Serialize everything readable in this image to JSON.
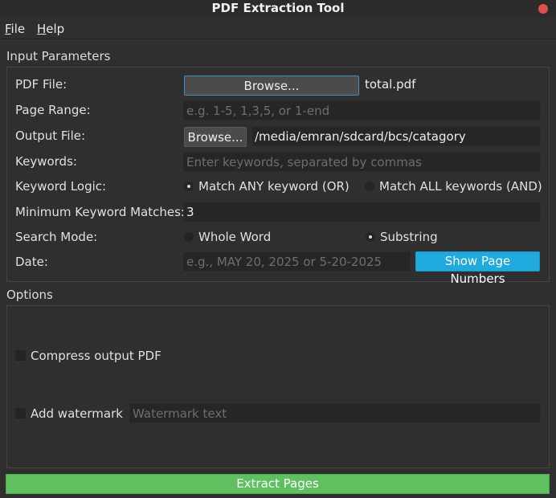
{
  "window": {
    "title": "PDF Extraction Tool"
  },
  "menu": {
    "file": {
      "accel": "F",
      "rest": "ile"
    },
    "help": {
      "accel": "H",
      "rest": "elp"
    }
  },
  "input_group": {
    "title": "Input Parameters",
    "pdf_file": {
      "label": "PDF File:",
      "button": "Browse...",
      "value": "total.pdf"
    },
    "page_range": {
      "label": "Page Range:",
      "placeholder": "e.g. 1-5, 1,3,5, or 1-end",
      "value": ""
    },
    "output_file": {
      "label": "Output File:",
      "button": "Browse...",
      "value": "/media/emran/sdcard/bcs/catagory"
    },
    "keywords": {
      "label": "Keywords:",
      "placeholder": "Enter keywords, separated by commas",
      "value": ""
    },
    "keyword_logic": {
      "label": "Keyword Logic:",
      "options": [
        "Match ANY keyword (OR)",
        "Match ALL keywords (AND)"
      ],
      "selected": "Match ANY keyword (OR)"
    },
    "min_matches": {
      "label": "Minimum Keyword Matches:",
      "value": "3"
    },
    "search_mode": {
      "label": "Search Mode:",
      "options": [
        "Whole Word",
        "Substring"
      ],
      "selected": "Substring"
    },
    "date": {
      "label": "Date:",
      "placeholder": "e.g., MAY 20, 2025 or 5-20-2025",
      "value": "",
      "button": "Show Page Numbers"
    }
  },
  "options_group": {
    "title": "Options",
    "compress": {
      "label": "Compress output PDF",
      "checked": false
    },
    "watermark": {
      "label": "Add watermark",
      "checked": false,
      "placeholder": "Watermark text",
      "value": ""
    }
  },
  "actions": {
    "extract": "Extract Pages"
  },
  "colors": {
    "accent_blue": "#1fa9dd",
    "extract_green": "#5ec05e",
    "close_red": "#e0504a"
  }
}
